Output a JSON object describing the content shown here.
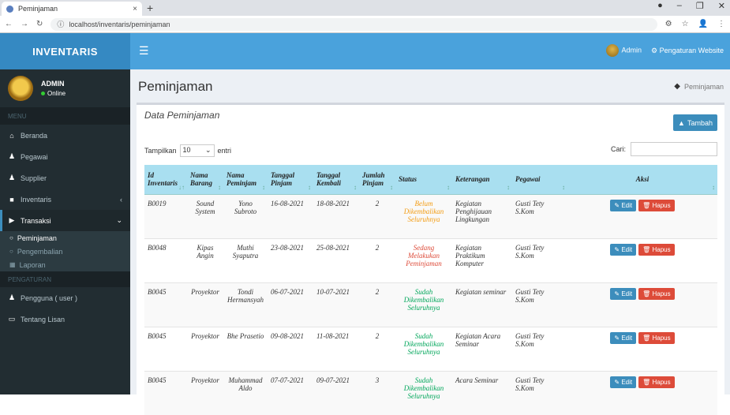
{
  "browser": {
    "tab_title": "Peminjaman",
    "url": "localhost/inventaris/peminjaman",
    "new_tab": "+",
    "close_tab": "×"
  },
  "navbar": {
    "brand": "INVENTARIS",
    "user": "Admin",
    "menu_link": "Pengaturan Website"
  },
  "sidebar": {
    "user_name": "ADMIN",
    "user_status": "Online",
    "header": "MENU",
    "items": [
      {
        "label": "Beranda",
        "icon": "home-icon"
      },
      {
        "label": "Pegawai",
        "icon": "user-icon"
      },
      {
        "label": "Supplier",
        "icon": "users-icon"
      },
      {
        "label": "Inventaris",
        "icon": "box-icon"
      },
      {
        "label": "Transaksi",
        "icon": "cart-icon"
      }
    ],
    "sub_items": [
      {
        "label": "Peminjaman"
      },
      {
        "label": "Pengembalian"
      },
      {
        "label": "Laporan"
      }
    ],
    "header2": "PENGATURAN",
    "items2": [
      {
        "label": "Pengguna ( user )",
        "icon": "user-icon"
      },
      {
        "label": "Tentang Lisan",
        "icon": "laptop-icon"
      }
    ]
  },
  "content": {
    "page_title": "Peminjaman",
    "breadcrumb": "Peminjaman",
    "box_title": "Data Peminjaman",
    "add_button": "Tambah",
    "show_label": "Tampilkan",
    "entries_value": "10",
    "entries_label": "entri",
    "search_label": "Cari:",
    "search_value": ""
  },
  "table": {
    "headers": [
      "Id Inventaris",
      "Nama Barang",
      "Nama Peminjam",
      "Tanggal Pinjam",
      "Tanggal Kembali",
      "Jumlah Pinjam",
      "Status",
      "Keterangan",
      "Pegawai",
      "Aksi"
    ],
    "rows": [
      {
        "id": "B0019",
        "barang": "Sound System",
        "peminjam": "Yono Subroto",
        "pinjam": "16-08-2021",
        "kembali": "18-08-2021",
        "jumlah": "2",
        "status": "Belum Dikembalikan Seluruhnya",
        "status_type": "orange",
        "ket": "Kegiatan Penghijauan Lingkungan",
        "pegawai": "Gusti Tety S.Kom"
      },
      {
        "id": "B0048",
        "barang": "Kipas Angin",
        "peminjam": "Muthi Syaputra",
        "pinjam": "23-08-2021",
        "kembali": "25-08-2021",
        "jumlah": "2",
        "status": "Sedang Melakukan Peminjaman",
        "status_type": "red",
        "ket": "Kegiatan Praktikum Komputer",
        "pegawai": "Gusti Tety S.Kom"
      },
      {
        "id": "B0045",
        "barang": "Proyektor",
        "peminjam": "Tondi Hermansyah",
        "pinjam": "06-07-2021",
        "kembali": "10-07-2021",
        "jumlah": "2",
        "status": "Sudah Dikembalikan Seluruhnya",
        "status_type": "green",
        "ket": "Kegiatan seminar",
        "pegawai": "Gusti Tety S.Kom"
      },
      {
        "id": "B0045",
        "barang": "Proyektor",
        "peminjam": "Bhe Prasetio",
        "pinjam": "09-08-2021",
        "kembali": "11-08-2021",
        "jumlah": "2",
        "status": "Sudah Dikembalikan Seluruhnya",
        "status_type": "green",
        "ket": "Kegiatan Acara Seminar",
        "pegawai": "Gusti Tety S.Kom"
      },
      {
        "id": "B0045",
        "barang": "Proyektor",
        "peminjam": "Muhammad Aldo",
        "pinjam": "07-07-2021",
        "kembali": "09-07-2021",
        "jumlah": "3",
        "status": "Sudah Dikembalikan Seluruhnya",
        "status_type": "green",
        "ket": "Acara Seminar",
        "pegawai": "Gusti Tety S.Kom"
      }
    ],
    "edit_label": "Edit",
    "delete_label": "Hapus"
  },
  "colors": {
    "navbar": "#4aa2dc",
    "sidebar": "#222d32",
    "table_header": "#a9dff0",
    "edit": "#3c8dbc",
    "delete": "#dd4b39"
  }
}
